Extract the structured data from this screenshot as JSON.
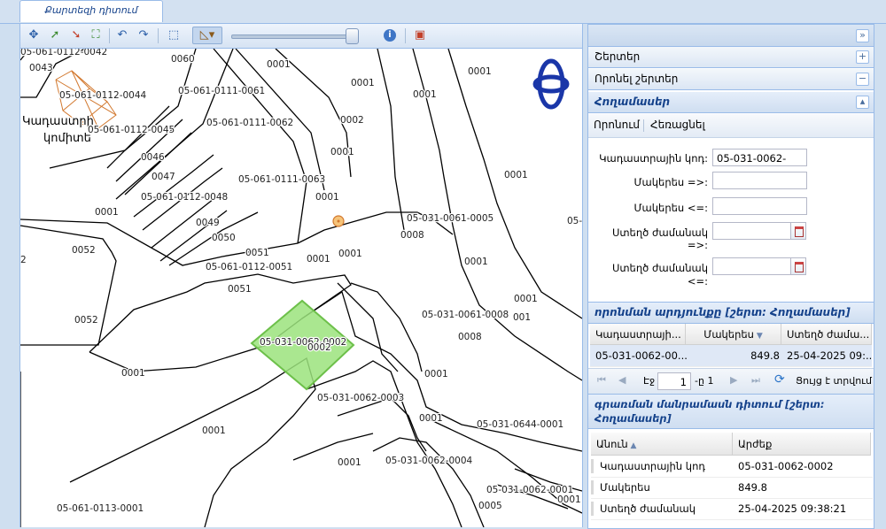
{
  "tab": {
    "label": "Քարտեզի դիտում"
  },
  "map": {
    "labels": [
      {
        "text": "05-061-0112-0042"
      },
      {
        "text": "0043"
      },
      {
        "text": "0060"
      },
      {
        "text": "0001"
      },
      {
        "text": "0001"
      },
      {
        "text": "05-061-0112-0044"
      },
      {
        "text": "05-061-0111-0061"
      },
      {
        "text": "0001"
      },
      {
        "text": "0001"
      },
      {
        "text": "Կադաստրի"
      },
      {
        "text": "կոմիտե"
      },
      {
        "text": "05-061-0112-0045"
      },
      {
        "text": "05-061-0111-0062"
      },
      {
        "text": "0002"
      },
      {
        "text": "0046"
      },
      {
        "text": "0001"
      },
      {
        "text": "0047"
      },
      {
        "text": "05-061-0111-0063"
      },
      {
        "text": "0001"
      },
      {
        "text": "0001"
      },
      {
        "text": "05-061-0112-0048"
      },
      {
        "text": "0001"
      },
      {
        "text": "0049"
      },
      {
        "text": "05-031-0061-0005"
      },
      {
        "text": "0008"
      },
      {
        "text": "05-"
      },
      {
        "text": "0050"
      },
      {
        "text": "0052"
      },
      {
        "text": "0051"
      },
      {
        "text": "0001"
      },
      {
        "text": "0001"
      },
      {
        "text": "0001"
      },
      {
        "text": "05-061-0112-0051"
      },
      {
        "text": "0051"
      },
      {
        "text": "0001"
      },
      {
        "text": "05-031-0061-0008"
      },
      {
        "text": "0052"
      },
      {
        "text": "001"
      },
      {
        "text": "0008"
      },
      {
        "text": "05-031-0062-0002"
      },
      {
        "text": "0002"
      },
      {
        "text": "0001"
      },
      {
        "text": "0001"
      },
      {
        "text": "05-031-0062-0003"
      },
      {
        "text": "0001"
      },
      {
        "text": "05-031-0644-0001"
      },
      {
        "text": "0001"
      },
      {
        "text": "0001"
      },
      {
        "text": "05-031-0062-0004"
      },
      {
        "text": "05-031-0062-0001"
      },
      {
        "text": "0001"
      },
      {
        "text": "05-061-0113-0001"
      },
      {
        "text": "0005"
      },
      {
        "text": "2"
      }
    ]
  },
  "right": {
    "layers_label": "Շերտեր",
    "search_layers_label": "Որոնել շերտեր",
    "section_title": "Հողամասեր",
    "search_tab": "Որոնում",
    "clear_tab": "Հեռացնել",
    "form": {
      "cadastral_label": "Կադաստրային կոդ:",
      "cadastral_value": "05-031-0062-0002",
      "area_gte_label": "Մակերես =>:",
      "area_lte_label": "Մակերես <=:",
      "created_gte_label_1": "Ստեղծ ժամանակ",
      "created_gte_label_2": "=>:",
      "created_lte_label_1": "Ստեղծ ժամանակ",
      "created_lte_label_2": "<=:"
    },
    "results": {
      "title": "որոնման արդյունքը [շերտ: Հողամասեր]",
      "col1": "Կադաստրայի...",
      "col2": "Մակերես",
      "col3": "Ստեղծ ժամա...",
      "row": {
        "code": "05-031-0062-00...",
        "area": "849.8",
        "created": "25-04-2025 09:..."
      },
      "pager_page_label": "Էջ",
      "pager_page": "1",
      "pager_of": "-ը 1",
      "pager_status": "Ցույց է տրվում"
    },
    "details": {
      "title_1": "գրառման մանրամասն դիտում [շերտ:",
      "title_2": "Հողամասեր]",
      "col_name": "Անուն",
      "col_value": "Արժեք",
      "rows": [
        {
          "name": "Կադաստրային կոդ",
          "value": "05-031-0062-0002"
        },
        {
          "name": "Մակերես",
          "value": "849.8"
        },
        {
          "name": "Ստեղծ ժամանակ",
          "value": "25-04-2025 09:38:21"
        }
      ]
    }
  }
}
